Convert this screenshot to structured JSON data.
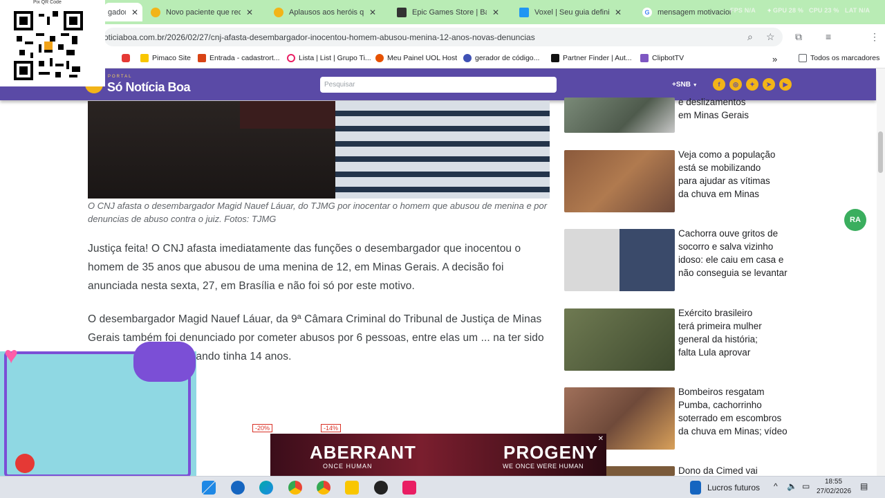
{
  "browser": {
    "tabs": [
      {
        "title": "gador",
        "active": true
      },
      {
        "title": "Novo paciente que recebe"
      },
      {
        "title": "Aplausos aos heróis que e"
      },
      {
        "title": "Epic Games Store | Baixe e"
      },
      {
        "title": "Voxel | Seu guia definitivo"
      },
      {
        "title": "mensagem motivacional"
      }
    ],
    "sys_overlay": [
      "FPS N/A",
      "GPU 28 %",
      "CPU 23 %",
      "LAT N/A"
    ],
    "url": "oticiaboa.com.br/2026/02/27/cnj-afasta-desembargador-inocentou-homem-abusou-menina-12-anos-novas-denuncias",
    "bookmarks": [
      "Pimaco Site",
      "Entrada - cadastrort...",
      "Lista | List | Grupo Ti...",
      "Meu Painel UOL Host",
      "gerador de código...",
      "Partner Finder | Aut...",
      "ClipbotTV"
    ],
    "all_bookmarks": "Todos os marcadores"
  },
  "site": {
    "logo_small": "PORTAL",
    "logo": "Só Notícia Boa",
    "search_placeholder": "Pesquisar",
    "region": "+SNB"
  },
  "article": {
    "caption": "O CNJ afasta o desembargador Magid Nauef Láuar, do TJMG por inocentar o homem que abusou de menina e por denuncias de abuso contra o juiz. Fotos: TJMG",
    "p1": "Justiça feita! O CNJ afasta imediatamente das funções o desembargador que inocentou o homem de 35 anos que abusou de uma menina de 12, em Minas Gerais. A decisão foi anunciada nesta sexta, 27, em Brasília e não foi só por este motivo.",
    "p2": "O desembargador Magid Nauef Láuar, da 9ª Câmara Criminal do Tribunal de Justiça de Minas Gerais também foi denunciado por cometer abusos por 6 pessoas, entre elas um ... na ter sido molestado pelo juiz quando tinha 14 anos."
  },
  "sidebar": {
    "items": [
      {
        "title": "e deslizamentos em Minas Gerais"
      },
      {
        "title": "Veja como a população está se mobilizando para ajudar as vítimas da chuva em Minas"
      },
      {
        "title": "Cachorra ouve gritos de socorro e salva vizinho idoso: ele caiu em casa e não conseguia se levantar"
      },
      {
        "title": "Exército brasileiro terá primeira mulher general da história; falta Lula aprovar"
      },
      {
        "title": "Bombeiros resgatam Pumba, cachorrinho soterrado em escombros da chuva em Minas; vídeo"
      },
      {
        "title": "Dono da Cimed vai"
      }
    ]
  },
  "overlay": {
    "qr_label": "Pix QR Code",
    "ra_badge": "RA"
  },
  "ad": {
    "title1": "ABERRANT",
    "sub1": "ONCE HUMAN",
    "title2": "PROGENY",
    "sub2": "WE ONCE WERE HUMAN",
    "discount1": "-20%",
    "discount2": "-14%"
  },
  "taskbar": {
    "widget": "Lucros futuros",
    "time": "18:55",
    "date": "27/02/2026"
  }
}
